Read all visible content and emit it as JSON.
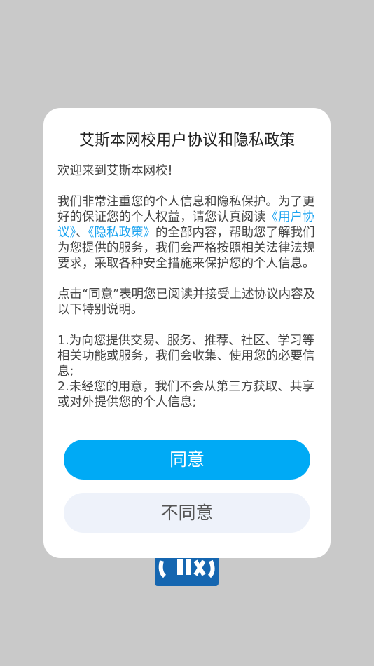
{
  "dialog": {
    "title": "艾斯本网校用户协议和隐私政策",
    "welcome": "欢迎来到艾斯本网校!",
    "para1_before": "我们非常注重您的个人信息和隐私保护。为了更好的保证您的个人权益，请您认真阅读",
    "link_user_agreement": "《用户协议》",
    "separator": "、",
    "link_privacy_policy": "《隐私政策》",
    "para1_after": "的全部内容，帮助您了解我们为您提供的服务，我们会严格按照相关法律法规要求，采取各种安全措施来保护您的个人信息。",
    "para2": "点击“同意”表明您已阅读并接受上述协议内容及以下特别说明。",
    "item1": "1.为向您提供交易、服务、推荐、社区、学习等相关功能或服务，我们会收集、使用您的必要信息;",
    "item2": "2.未经您的用意，我们不会从第三方获取、共享或对外提供您的个人信息;",
    "agree_label": "同意",
    "disagree_label": "不同意"
  },
  "colors": {
    "overlay_background": "#c9c9c9",
    "link": "#1aa3f0",
    "agree_button": "#00aaf5",
    "disagree_button": "#eef2fa",
    "logo": "#1566b0"
  }
}
